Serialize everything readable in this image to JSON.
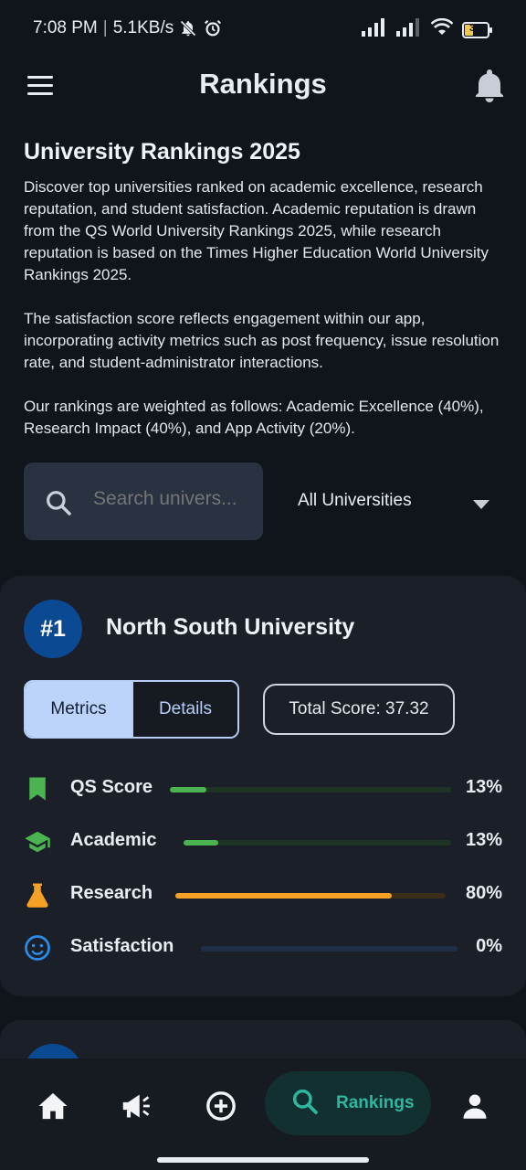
{
  "status_bar": {
    "time": "7:08 PM",
    "network_speed": "5.1KB/s",
    "battery_level": "31",
    "icons": [
      "bell-off-icon",
      "alarm-icon",
      "signal-icon",
      "signal-icon",
      "wifi-icon",
      "battery-icon"
    ]
  },
  "app_bar": {
    "title": "Rankings",
    "menu_icon": "hamburger-menu-icon",
    "notifications_icon": "bell-icon"
  },
  "intro": {
    "title": "University Rankings 2025",
    "paragraphs": [
      "Discover top universities ranked on academic excellence, research reputation, and student satisfaction. Academic reputation is drawn from the QS World University Rankings 2025, while research reputation is based on the Times Higher Education World University Rankings 2025.",
      "The satisfaction score reflects engagement within our app, incorporating activity metrics such as post frequency, issue resolution rate, and student-administrator interactions.",
      "Our rankings are weighted as follows: Academic Excellence (40%), Research Impact (40%), and App Activity (20%)."
    ]
  },
  "search": {
    "placeholder": "Search univers..."
  },
  "filter": {
    "selected": "All Universities"
  },
  "ranking_card": {
    "rank": "#1",
    "university": "North South University",
    "tabs": [
      "Metrics",
      "Details"
    ],
    "active_tab": "Metrics",
    "total_score_label": "Total Score: 37.32",
    "metrics": [
      {
        "label": "QS Score",
        "value": "13%",
        "fraction": 0.13,
        "icon": "bookmark-icon",
        "color": "#4bb34f",
        "track": "#1f3324"
      },
      {
        "label": "Academic",
        "value": "13%",
        "fraction": 0.13,
        "icon": "graduation-cap-icon",
        "color": "#4bb34f",
        "track": "#1f3324"
      },
      {
        "label": "Research",
        "value": "80%",
        "fraction": 0.8,
        "icon": "flask-icon",
        "color": "#f5a125",
        "track": "#3a2e1b"
      },
      {
        "label": "Satisfaction",
        "value": "0%",
        "fraction": 0.0,
        "icon": "smiley-icon",
        "color": "#2b8ce8",
        "track": "#1d2e45"
      }
    ]
  },
  "bottom_nav": {
    "items": [
      {
        "icon": "home-icon"
      },
      {
        "icon": "megaphone-icon"
      },
      {
        "icon": "add-circle-icon"
      },
      {
        "icon": "search-icon",
        "label": "Rankings",
        "active": true
      },
      {
        "icon": "person-icon"
      }
    ]
  },
  "colors": {
    "background": "#10141b",
    "card": "#1b1f27",
    "accent_teal": "#2fb6a1",
    "rank_badge": "#0b4a93"
  }
}
